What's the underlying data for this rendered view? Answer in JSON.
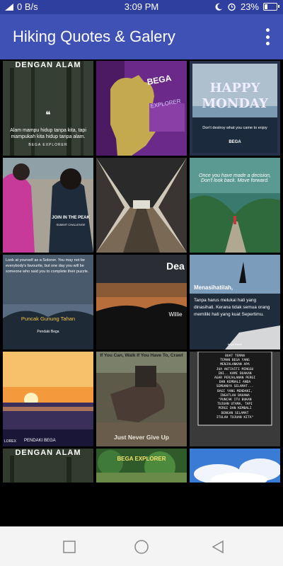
{
  "status_bar": {
    "net_speed": "0 B/s",
    "time": "3:09 PM",
    "battery": "23%",
    "battery_level": 0.23
  },
  "app_bar": {
    "title": "Hiking Quotes & Galery",
    "overflow_icon": "more-vert-icon"
  },
  "tiles": {
    "t1": {
      "header": "DENGAN ALAM",
      "quote": "Alam mampu hidup tanpa kita, tapi mampukah kita hidup tanpa alam.",
      "brand": "BEGA EXPLORER"
    },
    "t2": {
      "brand": "BEGA",
      "sub": "EXPLORER"
    },
    "t3": {
      "line1": "HAPPY",
      "line2": "MONDAY",
      "sub": "Don't destroy what you came to enjoy",
      "brand": "BEGA"
    },
    "t4": {
      "shirt_text": "JOIN IN THE PEAK",
      "shirt_sub": "SUMMIT CHALLENGE"
    },
    "t6": {
      "quote": "Once you have made a decision, Don't look back. Move forward."
    },
    "t7": {
      "quote": "Look at yourself as a Soloner. You may not be everybody's favourite, but one day you will be someone who said you to complete their puzzle.",
      "title": "Puncak Gunung Tahan",
      "brand": "Pendaki Bega"
    },
    "t8": {
      "word1": "Dea",
      "word2": "Willie"
    },
    "t9": {
      "title": "Menasihatilah,",
      "quote": "Tanpa harus melukai hati yang dinasihati. Kerana tidak semua orang memiliki hati yang kuat Sepertimu.",
      "credit": "bega island"
    },
    "t10": {
      "brand": "PENDAKI BEGA",
      "brand_left": "LOREX"
    },
    "t11": {
      "top": "If You Can, Walk If You Have To, Crawl",
      "bottom": "Just Never Give Up"
    },
    "t12": {
      "lines": [
        "BUAT TEMAN",
        "TEMAN BEGA YANG",
        "MENJALANKAN APA",
        "JUA AKTIVITI MINGGU",
        "INI.. KAMI DOAKAN",
        "AGAR PERJALANAN PERGI",
        "DAN KEMBALI ANDA",
        "SEMUANYA SELAMAT...",
        "BAGI YANG MENDAKI,",
        "INGATLAH BAHAWA",
        "\"PUNCAK ITU BUKAN",
        "TUJUAN UTAMA, TAPI",
        "PERGI DAN KEMBALI",
        "DENGAN SELAMAT",
        "ITULAH TUJUAN KITA\""
      ]
    },
    "t13": {
      "header": "DENGAN ALAM"
    },
    "t14": {
      "brand": "BEGA EXPLORER"
    }
  },
  "nav": {
    "recents_icon": "square-icon",
    "home_icon": "circle-icon",
    "back_icon": "triangle-back-icon"
  }
}
